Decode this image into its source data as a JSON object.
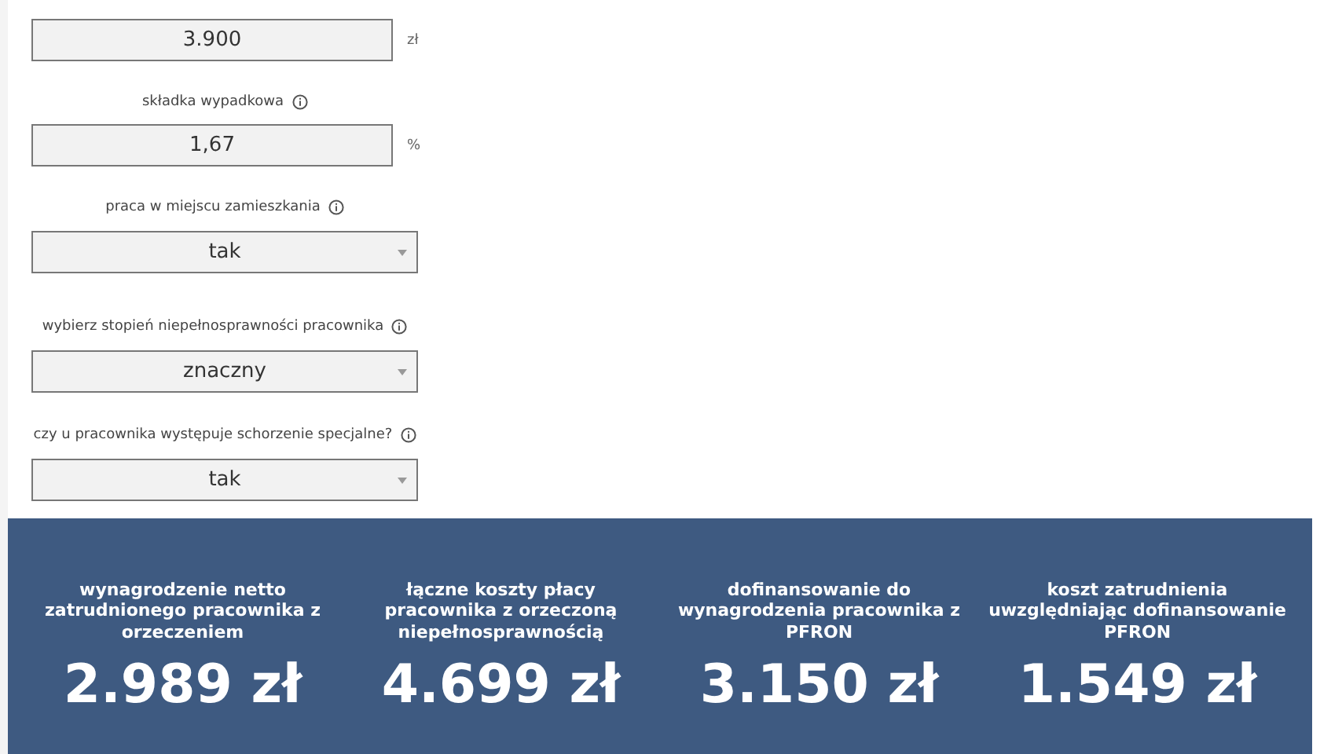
{
  "fields": [
    {
      "kind": "number",
      "value": "3.900",
      "unit": "zł"
    },
    {
      "kind": "number",
      "label": "składka wypadkowa",
      "value": "1,67",
      "unit": "%"
    },
    {
      "kind": "select",
      "label": "praca w miejscu zamieszkania",
      "value": "tak"
    },
    {
      "kind": "select",
      "label": "wybierz stopień niepełnosprawności pracownika",
      "value": "znaczny"
    },
    {
      "kind": "select",
      "label": "czy u pracownika występuje schorzenie specjalne?",
      "value": "tak"
    }
  ],
  "results": [
    {
      "label": "wynagrodzenie netto zatrudnionego pracownika z orzeczeniem",
      "value": "2.989 zł"
    },
    {
      "label": "łączne koszty płacy pracownika z orzeczoną niepełnosprawnością",
      "value": "4.699 zł"
    },
    {
      "label": "dofinansowanie do wynagrodzenia pracownika z PFRON",
      "value": "3.150 zł"
    },
    {
      "label": "koszt zatrudnienia uwzględniając dofinansowanie PFRON",
      "value": "1.549 zł"
    }
  ]
}
